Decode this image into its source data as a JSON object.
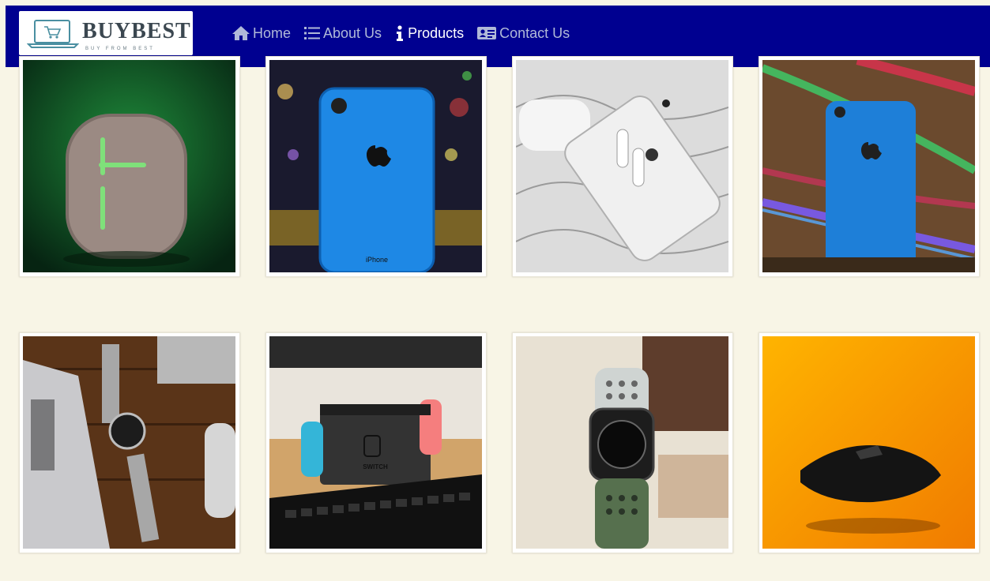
{
  "brand": {
    "name": "BUYBEST",
    "tagline": "BUY FROM BEST"
  },
  "nav": {
    "items": [
      {
        "label": "Home",
        "icon": "home-icon",
        "active": false
      },
      {
        "label": "About Us",
        "icon": "list-icon",
        "active": false
      },
      {
        "label": "Products",
        "icon": "info-icon",
        "active": true
      },
      {
        "label": "Contact Us",
        "icon": "id-card-icon",
        "active": false
      }
    ]
  },
  "colors": {
    "navbar": "#000090",
    "page_background": "#f8f5e6",
    "nav_text": "#b0b9d8",
    "nav_active": "#ffffff"
  },
  "products": [
    {
      "name": "bluetooth-speaker"
    },
    {
      "name": "blue-iphone-xr",
      "printed_label": "iPhone"
    },
    {
      "name": "white-iphone-airpods"
    },
    {
      "name": "blue-iphone-neon-lights"
    },
    {
      "name": "mesh-strap-wristwatch"
    },
    {
      "name": "nintendo-switch-dock",
      "printed_label": "SWITCH"
    },
    {
      "name": "apple-watch-sport"
    },
    {
      "name": "wireless-mouse"
    }
  ]
}
